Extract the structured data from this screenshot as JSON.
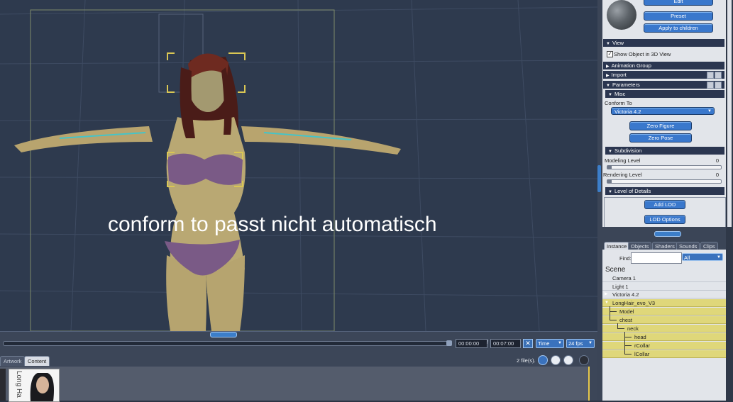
{
  "viewport": {
    "overlay_caption": "conform to passt nicht automatisch"
  },
  "timeline": {
    "current_time": "00:00:00",
    "separator": "/",
    "end_time": "00:07:00",
    "mode": "Time",
    "fps": "24 fps"
  },
  "content_panel": {
    "tabs": [
      "Artwork",
      "Content"
    ],
    "active_tab": "Content",
    "file_count": "2 file(s).",
    "thumbnail_label": "Long Ha"
  },
  "properties": {
    "buttons_top": [
      "Edit",
      "Preset",
      "Apply to children"
    ],
    "view_section": "View",
    "show_object_label": "Show Object in 3D View",
    "show_object_checked": true,
    "animation_group": "Animation Group",
    "import_section": "Import",
    "parameters_section": "Parameters",
    "misc_section": "Misc",
    "conform_to_label": "Conform To",
    "conform_to_value": "Victoria 4.2",
    "zero_figure": "Zero Figure",
    "zero_pose": "Zero Pose",
    "subdivision_section": "Subdivision",
    "modeling_level_label": "Modeling Level",
    "modeling_level_value": "0",
    "rendering_level_label": "Rendering Level",
    "rendering_level_value": "0",
    "lod_section": "Level of Details",
    "add_lod": "Add LOD",
    "lod_options": "LOD Options"
  },
  "scene_panel": {
    "tabs": [
      "Instance",
      "Objects",
      "Shaders",
      "Sounds",
      "Clips"
    ],
    "active_tab": "Instance",
    "find_label": "Find:",
    "find_value": "",
    "filter_value": "All",
    "scene_title": "Scene",
    "tree": [
      {
        "label": "Camera 1",
        "selected": false
      },
      {
        "label": "Light 1",
        "selected": false
      },
      {
        "label": "Victoria 4.2",
        "selected": false
      },
      {
        "label": "LongHair_evo_V3",
        "selected": true
      },
      {
        "label": "Model",
        "selected": true
      },
      {
        "label": "chest",
        "selected": true
      },
      {
        "label": "neck",
        "selected": true
      },
      {
        "label": "head",
        "selected": true
      },
      {
        "label": "rCollar",
        "selected": true
      },
      {
        "label": "lCollar",
        "selected": true
      }
    ]
  },
  "colors": {
    "viewport_bg": "#2e3a4e",
    "accent_button": "#3a78cc",
    "section_header": "#2b3650",
    "selection": "#dfd77a"
  }
}
